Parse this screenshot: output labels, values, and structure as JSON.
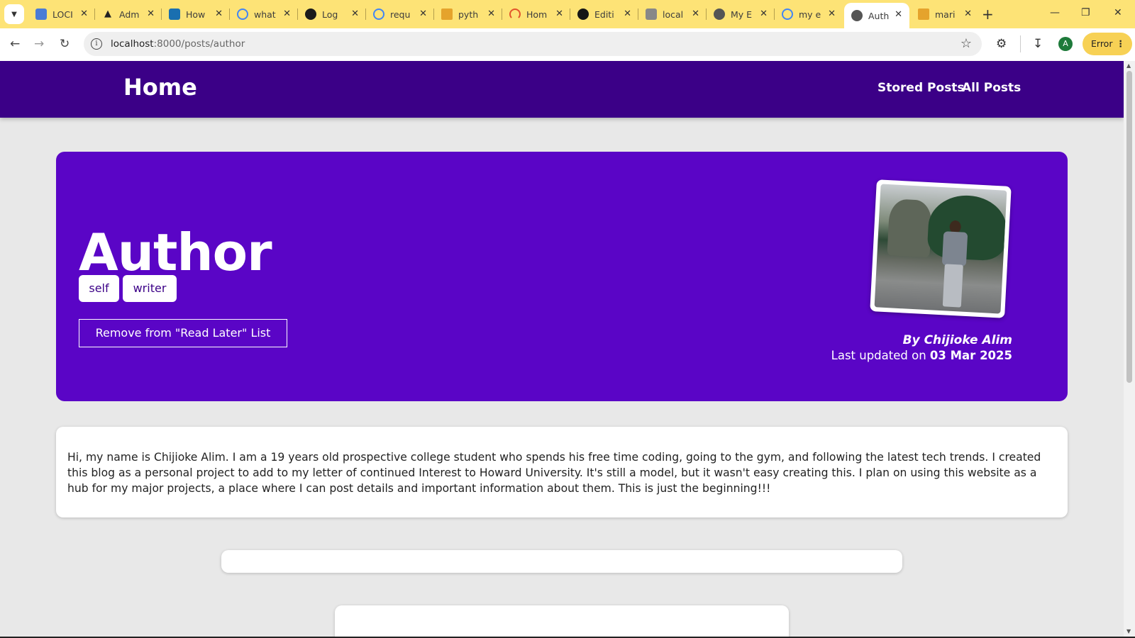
{
  "browser": {
    "tabs": [
      {
        "label": "LOCI",
        "favicon_color": "#4a7bd6"
      },
      {
        "label": "Adm",
        "favicon_color": "#222222"
      },
      {
        "label": "How",
        "favicon_color": "#1a6fb0"
      },
      {
        "label": "what",
        "favicon_color": "#4285f4"
      },
      {
        "label": "Log",
        "favicon_color": "#1b1b1b"
      },
      {
        "label": "requ",
        "favicon_color": "#4285f4"
      },
      {
        "label": "pyth",
        "favicon_color": "#e5a32c"
      },
      {
        "label": "Hom",
        "favicon_color": "#e2542c"
      },
      {
        "label": "Editi",
        "favicon_color": "#161616"
      },
      {
        "label": "local",
        "favicon_color": "#888888"
      },
      {
        "label": "My E",
        "favicon_color": "#555555"
      },
      {
        "label": "my e",
        "favicon_color": "#4285f4"
      },
      {
        "label": "Auth",
        "favicon_color": "#555555"
      },
      {
        "label": "mari",
        "favicon_color": "#e5a32c"
      }
    ],
    "active_tab_index": 12,
    "url_host": "localhost",
    "url_path": ":8000/posts/author",
    "profile_initial": "A",
    "error_label": "Error"
  },
  "site": {
    "logo": "Home",
    "nav": [
      "Stored Posts",
      "All Posts"
    ]
  },
  "post": {
    "title": "Author",
    "tags": [
      "self",
      "writer"
    ],
    "read_later_button": "Remove from \"Read Later\" List",
    "author_line": "By Chijioke Alim",
    "updated_prefix": "Last updated on ",
    "updated_date": "03 Mar 2025",
    "body": "Hi, my name is Chijioke Alim. I am a 19 years old prospective college student who spends his free time coding, going to the gym, and following the latest tech trends. I created this blog as a personal project to add to my letter of continued Interest to Howard University. It's still a model, but it wasn't easy creating this. I plan on using this website as a hub for my major projects, a place where I can post details and important information about them. This is just the beginning!!!"
  },
  "colors": {
    "header_bg": "#3b0087",
    "hero_bg": "#5a05c6",
    "page_bg": "#e8e8e8",
    "tabstrip_bg": "#fde376"
  }
}
